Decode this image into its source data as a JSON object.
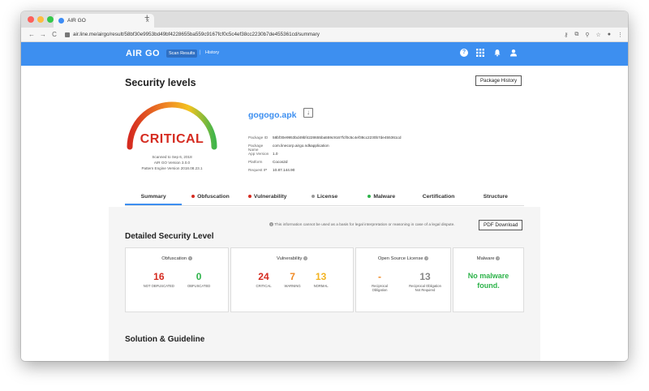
{
  "browser": {
    "tab_title": "AIR GO",
    "tab_close": "×",
    "new_tab": "+",
    "url": "air.line.me/airgo/result/58bf30e9953bd49bf4228655ba559c9167fcf0c5c4ef38cc2230b7de455361cd/summary",
    "back": "←",
    "forward": "→",
    "reload": "C"
  },
  "app": {
    "logo": "AIR GO",
    "nav_scan": "Scan Results",
    "nav_sep": "|",
    "nav_history": "History",
    "help_glyph": "?"
  },
  "page": {
    "title": "Security levels",
    "package_history_btn": "Package History",
    "level": "CRITICAL",
    "scan_date": "Scanned to Sep 6, 2018",
    "airgo_version": "AIR GO Version 3.0.0",
    "pattern_version": "Pattern Engine Version 2018.08.23.1",
    "file_name": "gogogo.apk",
    "meta": [
      {
        "k": "Package ID",
        "v": "58bf30e9953bd49bf4228655ba559c9167fcf0c5c4ef38cc2230b7de455361cd"
      },
      {
        "k": "Package Name",
        "v": "com.linecorp.airgo.ndkapplication"
      },
      {
        "k": "App Version",
        "v": "1.0"
      },
      {
        "k": "Platform",
        "v": "Cocos2d"
      },
      {
        "k": "Request IP",
        "v": "10.87.144.90"
      }
    ],
    "tabs": [
      "Summary",
      "Obfuscation",
      "Vulnerability",
      "License",
      "Malware",
      "Certification",
      "Structure"
    ],
    "disclaimer": "This information cannot be used as a basis for legal interpretation or reasoning in case of a legal dispute.",
    "pdf_btn": "PDF Download",
    "detailed_title": "Detailed Security Level",
    "solution_title": "Solution & Guideline"
  },
  "cards": {
    "obfuscation": {
      "title": "Obfuscation",
      "values": [
        {
          "val": "16",
          "lbl": "NOT OBFUSCATED"
        },
        {
          "val": "0",
          "lbl": "OBFUSCATED"
        }
      ]
    },
    "vulnerability": {
      "title": "Vulnerability",
      "values": [
        {
          "val": "24",
          "lbl": "CRITICAL"
        },
        {
          "val": "7",
          "lbl": "WARNING"
        },
        {
          "val": "13",
          "lbl": "NORMAL"
        }
      ]
    },
    "license": {
      "title": "Open Source License",
      "values": [
        {
          "val": "-",
          "lbl": "Reciprocal Obligation"
        },
        {
          "val": "13",
          "lbl": "Reciprocal Obligation Not Required"
        }
      ]
    },
    "malware": {
      "title": "Malware",
      "text1": "No malware",
      "text2": "found."
    }
  },
  "colors": {
    "accent": "#3d8ff0",
    "critical": "#d52b20",
    "warning": "#f08a24",
    "normal": "#f3b320",
    "good": "#2db34a",
    "muted": "#888888"
  }
}
